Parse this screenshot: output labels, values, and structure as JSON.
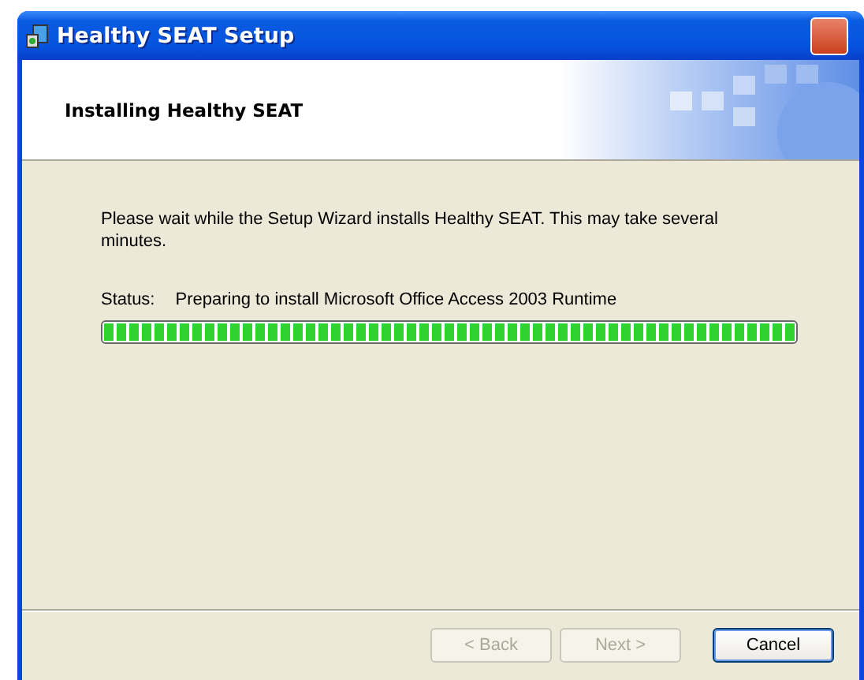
{
  "window": {
    "title": "Healthy SEAT Setup"
  },
  "header": {
    "title": "Installing Healthy SEAT"
  },
  "message": "Please wait while the Setup Wizard installs Healthy SEAT.  This may take several minutes.",
  "status": {
    "label": "Status:",
    "text": "Preparing to install Microsoft Office Access 2003 Runtime"
  },
  "progress": {
    "level": 1
  },
  "buttons": [
    {
      "label": "< Back",
      "disabled": true,
      "focused": false
    },
    {
      "label": "Next >",
      "disabled": true,
      "focused": false
    },
    {
      "label": "Cancel",
      "disabled": false,
      "focused": true
    }
  ]
}
